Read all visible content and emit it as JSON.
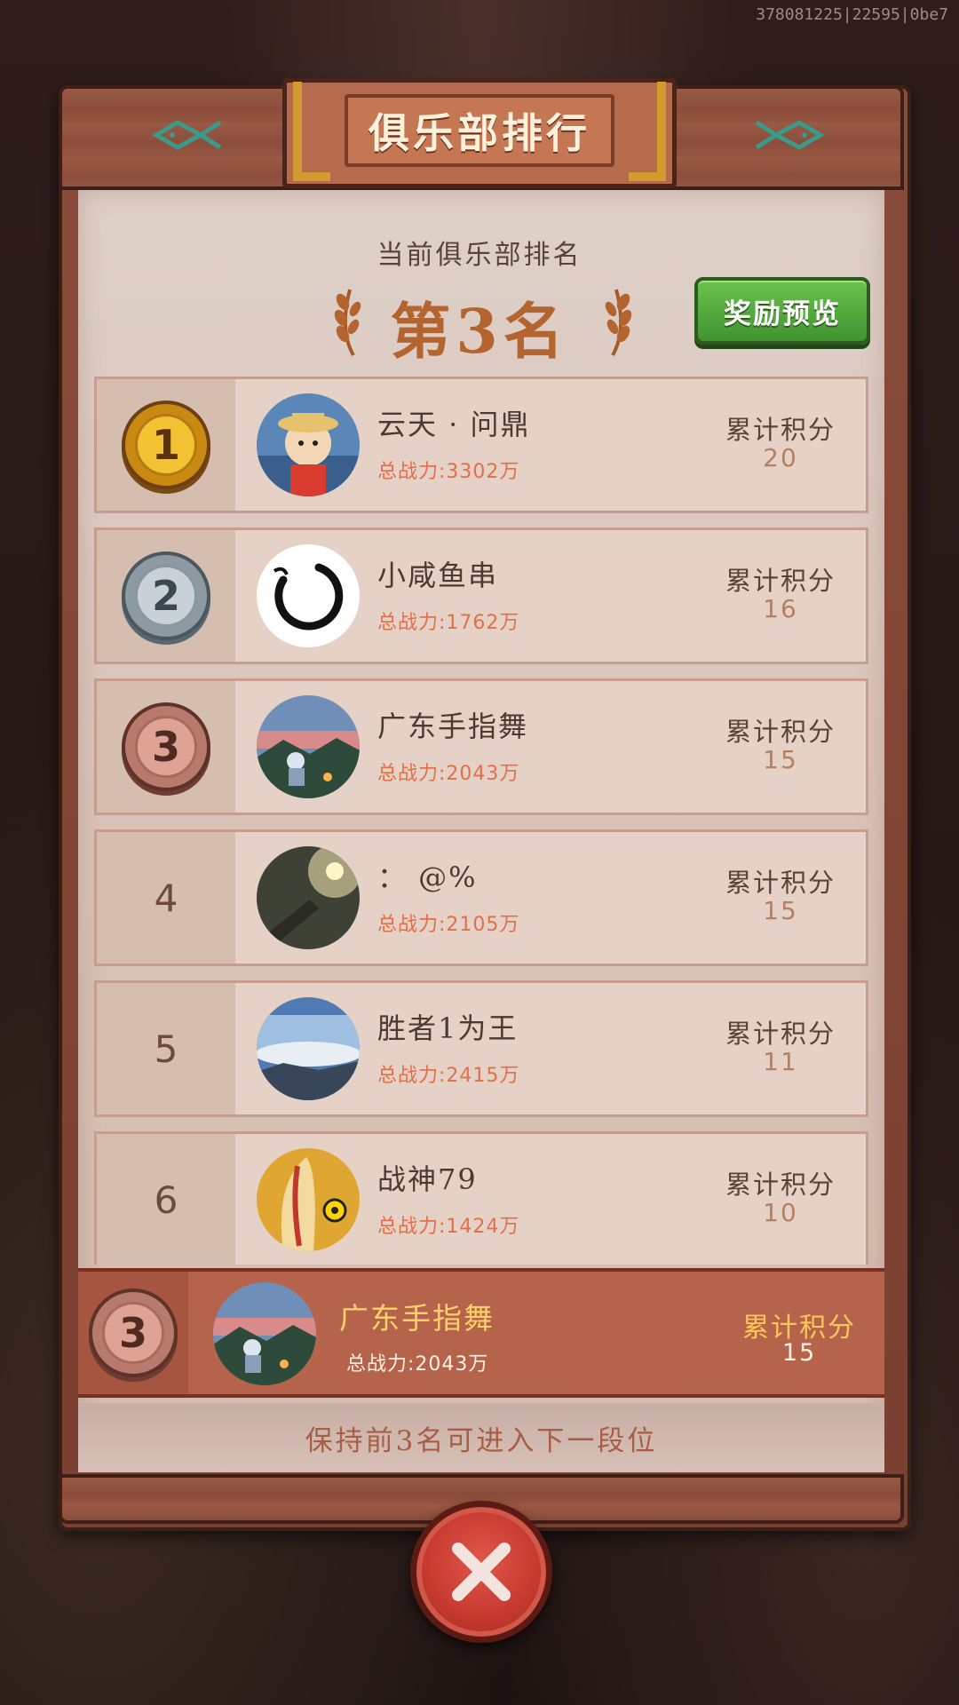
{
  "debug_id": "378081225|22595|0be7",
  "title": "俱乐部排行",
  "current_rank_label": "当前俱乐部排名",
  "current_rank_value": "第3名",
  "reward_button": "奖励预览",
  "rows": [
    {
      "rank": "1",
      "medal": "gold",
      "name": "云天 · 问鼎",
      "power": "总战力:3302万",
      "score_label": "累计积分",
      "score": "20",
      "avatar": "cartoon-boy-avatar"
    },
    {
      "rank": "2",
      "medal": "silver",
      "name": "小咸鱼串",
      "power": "总战力:1762万",
      "score_label": "累计积分",
      "score": "16",
      "avatar": "ink-circle-avatar"
    },
    {
      "rank": "3",
      "medal": "bronze",
      "name": "广东手指舞",
      "power": "总战力:2043万",
      "score_label": "累计积分",
      "score": "15",
      "avatar": "mountain-campfire-avatar"
    },
    {
      "rank": "4",
      "medal": "",
      "name": "： @%",
      "power": "总战力:2105万",
      "score_label": "累计积分",
      "score": "15",
      "avatar": "flashlight-avatar"
    },
    {
      "rank": "5",
      "medal": "",
      "name": "胜者1为王",
      "power": "总战力:2415万",
      "score_label": "累计积分",
      "score": "11",
      "avatar": "sky-clouds-avatar"
    },
    {
      "rank": "6",
      "medal": "",
      "name": "战神79",
      "power": "总战力:1424万",
      "score_label": "累计积分",
      "score": "10",
      "avatar": "hotdog-cartoon-avatar"
    }
  ],
  "my_row": {
    "rank": "3",
    "name": "广东手指舞",
    "power": "总战力:2043万",
    "score_label": "累计积分",
    "score": "15"
  },
  "tip": "保持前3名可进入下一段位",
  "colors": {
    "accent_orange": "#b4642f",
    "green_button": "#4fa83a",
    "my_row": "#b5634a",
    "close_red": "#c73a30"
  }
}
